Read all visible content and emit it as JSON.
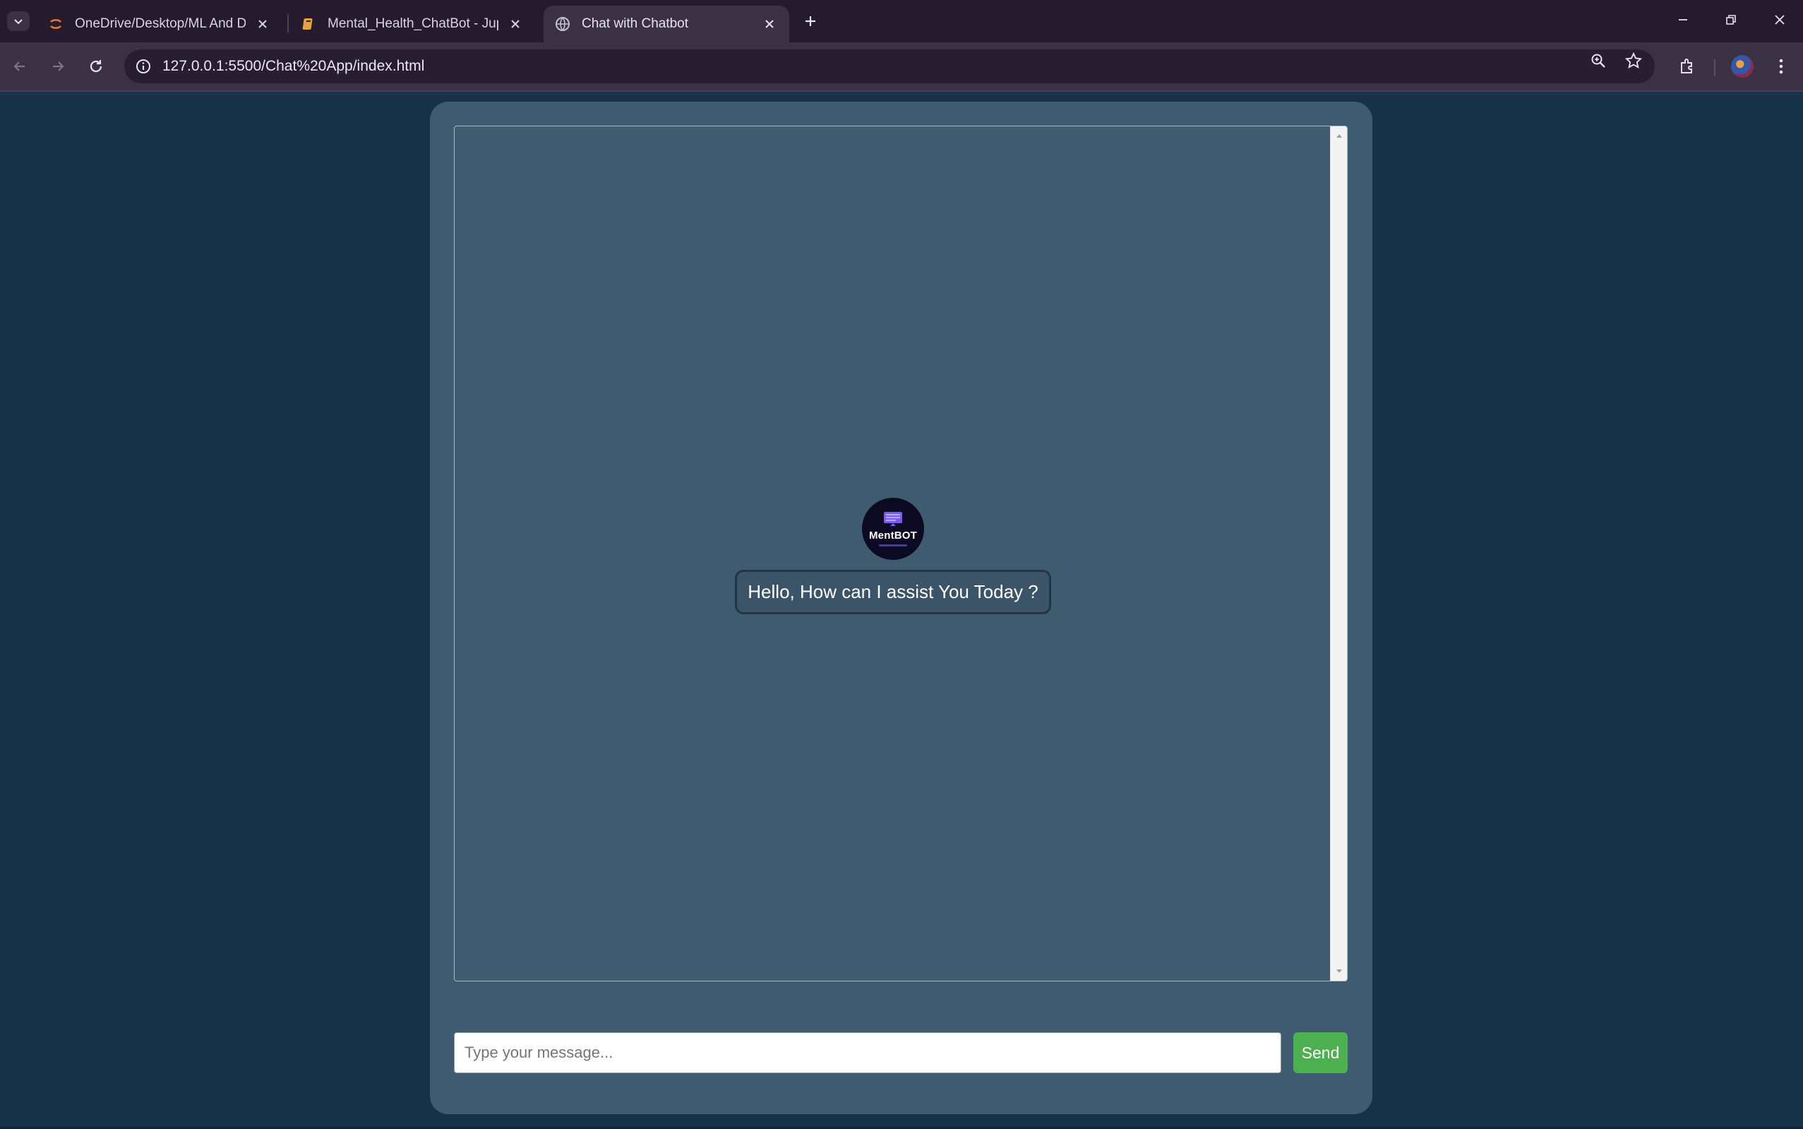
{
  "browser": {
    "tabs": [
      {
        "title": "OneDrive/Desktop/ML And DL/",
        "icon": "jupyter-icon",
        "active": false
      },
      {
        "title": "Mental_Health_ChatBot - Jupyte",
        "icon": "notebook-icon",
        "active": false
      },
      {
        "title": "Chat with Chatbot",
        "icon": "globe-icon",
        "active": true
      }
    ],
    "url": "127.0.0.1:5500/Chat%20App/index.html"
  },
  "chat": {
    "bot_logo_text": "MentBOT",
    "greeting": "Hello, How can I assist You Today ?",
    "input_placeholder": "Type your message...",
    "input_value": "",
    "send_label": "Send"
  },
  "colors": {
    "page_background": "#163249",
    "card_background": "#3e5b70",
    "send_button": "#4caf50",
    "bubble_border": "#223547"
  }
}
